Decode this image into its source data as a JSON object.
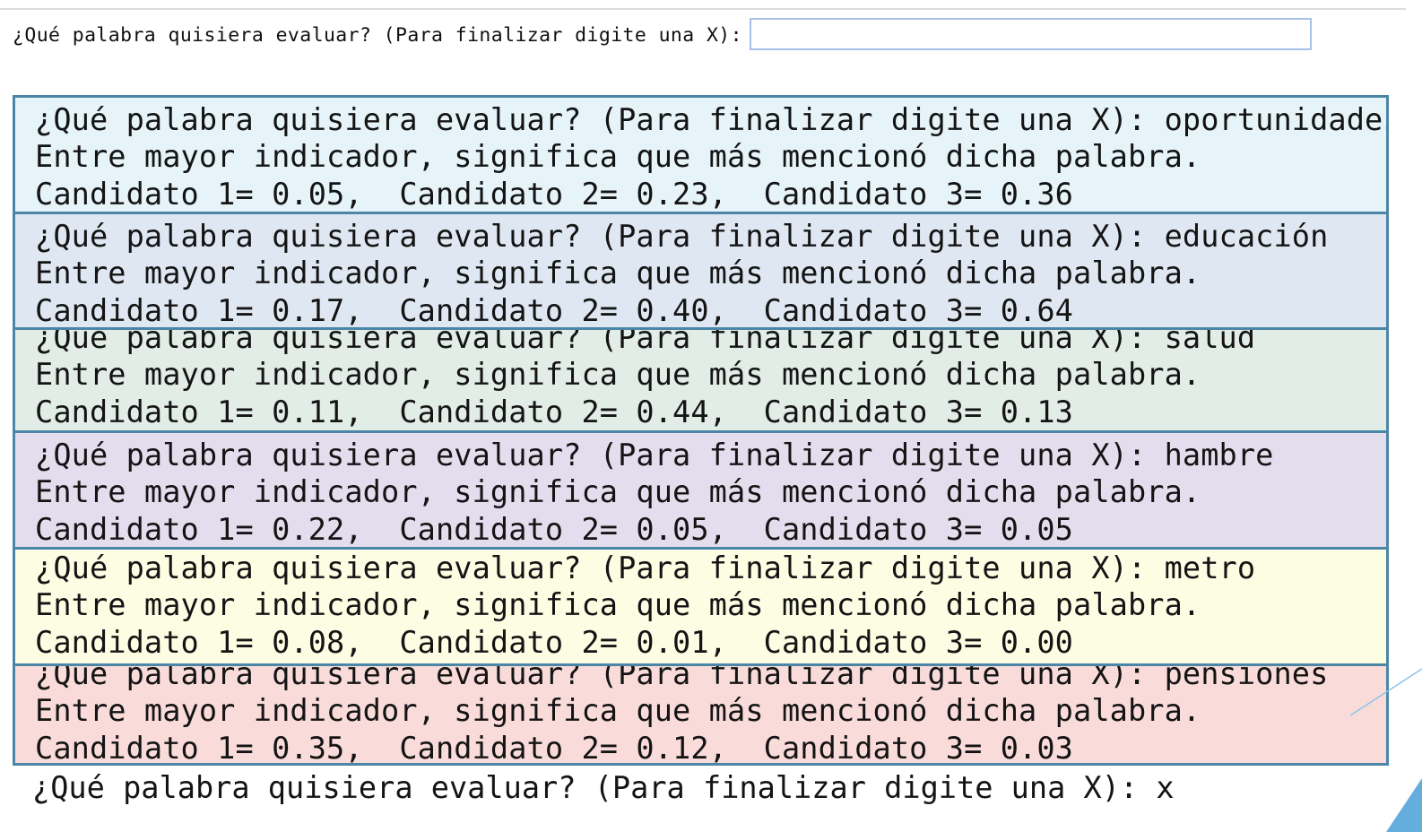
{
  "prompt": {
    "label": "¿Qué palabra quisiera evaluar? (Para finalizar digite una X):",
    "input_value": ""
  },
  "results": [
    {
      "question": "¿Qué palabra quisiera evaluar? (Para finalizar digite una X): oportunidades",
      "explanation": "Entre mayor indicador, significa que más mencionó dicha palabra.",
      "scores": "Candidato 1= 0.05,  Candidato 2= 0.23,  Candidato 3= 0.36",
      "bg": "#e6f4fa"
    },
    {
      "question": "¿Qué palabra quisiera evaluar? (Para finalizar digite una X): educación",
      "explanation": "Entre mayor indicador, significa que más mencionó dicha palabra.",
      "scores": "Candidato 1= 0.17,  Candidato 2= 0.40,  Candidato 3= 0.64",
      "bg": "#dfe8f2"
    },
    {
      "question": "¿Qué palabra quisiera evaluar? (Para finalizar digite una X): salud",
      "explanation": "Entre mayor indicador, significa que más mencionó dicha palabra.",
      "scores": "Candidato 1= 0.11,  Candidato 2= 0.44,  Candidato 3= 0.13",
      "bg": "#e1ede6"
    },
    {
      "question": "¿Qué palabra quisiera evaluar? (Para finalizar digite una X): hambre",
      "explanation": "Entre mayor indicador, significa que más mencionó dicha palabra.",
      "scores": "Candidato 1= 0.22,  Candidato 2= 0.05,  Candidato 3= 0.05",
      "bg": "#e4ddee"
    },
    {
      "question": "¿Qué palabra quisiera evaluar? (Para finalizar digite una X): metro",
      "explanation": "Entre mayor indicador, significa que más mencionó dicha palabra.",
      "scores": "Candidato 1= 0.08,  Candidato 2= 0.01,  Candidato 3= 0.00",
      "bg": "#fcfde3"
    },
    {
      "question": "¿Qué palabra quisiera evaluar? (Para finalizar digite una X): pensiones",
      "explanation": "Entre mayor indicador, significa que más mencionó dicha palabra.",
      "scores": "Candidato 1= 0.35,  Candidato 2= 0.12,  Candidato 3= 0.03",
      "bg": "#f9dcda"
    }
  ],
  "final_line": "¿Qué palabra quisiera evaluar? (Para finalizar digite una X): x",
  "colors": {
    "block_border": "#4b86a6",
    "input_border": "#a6c0ea",
    "decoration": "#4a9fd6"
  }
}
